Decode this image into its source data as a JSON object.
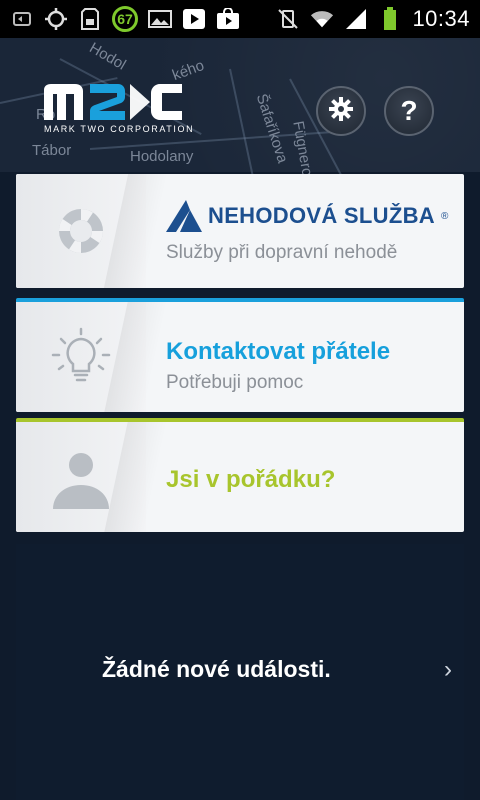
{
  "status_bar": {
    "time": "10:34",
    "badge_value": "67",
    "icons": [
      "screen-record-icon",
      "gps-icon",
      "sdcard-icon",
      "notification-badge-icon",
      "image-icon",
      "play-store-icon",
      "shopping-bag-icon",
      "vibrate-mute-icon",
      "wifi-icon",
      "signal-icon",
      "battery-icon"
    ]
  },
  "header": {
    "logo_text": "m2C",
    "logo_subtitle": "MARK TWO CORPORATION",
    "map_labels": [
      "Hodolany",
      "Šafaříkova",
      "Tábor",
      "Fügnerova",
      "Hodol",
      "kého",
      "Ro"
    ],
    "settings_icon": "gear-icon",
    "help_label": "?"
  },
  "cards": [
    {
      "id": "nehodova-sluzba",
      "brand": "NEHODOVÁ SLUŽBA",
      "brand_mark": "®",
      "subtitle": "Služby při dopravní nehodě",
      "icon": "lifebuoy-icon"
    },
    {
      "id": "kontaktovat-pratele",
      "title": "Kontaktovat přátele",
      "subtitle": "Potřebuji pomoc",
      "icon": "lightbulb-icon",
      "accent": "#1aa0dc"
    },
    {
      "id": "jsi-v-poradku",
      "title": "Jsi v pořádku?",
      "icon": "person-icon",
      "accent": "#a8c52d"
    }
  ],
  "events": {
    "text": "Žádné nové události.",
    "chevron": "›"
  },
  "colors": {
    "background": "#0f1b2c",
    "brand_blue": "#1c4f8f",
    "blue_accent": "#1aa0dc",
    "green_accent": "#a8c52d"
  }
}
